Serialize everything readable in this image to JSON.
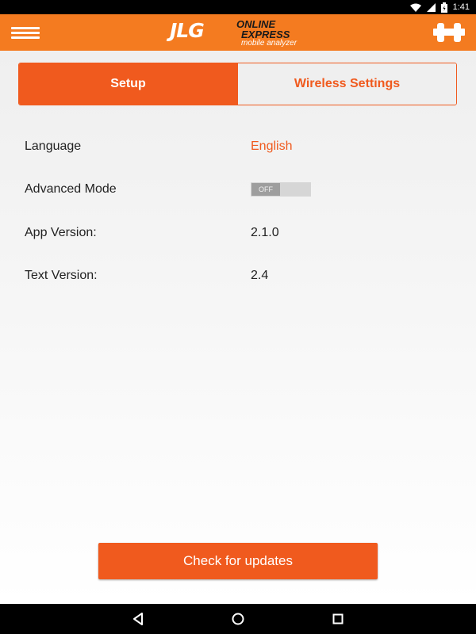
{
  "status_bar": {
    "time": "1:41",
    "icons": [
      "wifi-icon",
      "cell-signal-icon",
      "battery-icon"
    ]
  },
  "app_bar": {
    "logo": {
      "brand": "JLG",
      "line1": "ONLINE",
      "line2": "EXPRESS",
      "tagline": "mobile analyzer"
    },
    "menu_icon": "hamburger-menu-icon",
    "action_icon": "connector-icon"
  },
  "tabs": [
    {
      "label": "Setup",
      "active": true
    },
    {
      "label": "Wireless Settings",
      "active": false
    }
  ],
  "settings": {
    "language": {
      "label": "Language",
      "value": "English"
    },
    "advanced_mode": {
      "label": "Advanced Mode",
      "toggle_text": "OFF",
      "enabled": false
    },
    "app_version": {
      "label": "App Version:",
      "value": "2.1.0"
    },
    "text_version": {
      "label": "Text Version:",
      "value": "2.4"
    }
  },
  "update_button": {
    "label": "Check for updates"
  },
  "nav_bar": {
    "icons": [
      "back-icon",
      "home-icon",
      "recents-icon"
    ]
  },
  "colors": {
    "accent": "#f05a1e",
    "app_bar": "#f47b20"
  }
}
